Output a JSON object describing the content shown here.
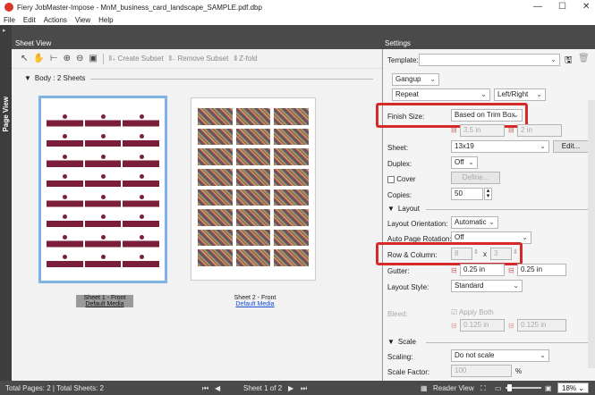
{
  "window": {
    "title": "Fiery JobMaster-Impose - MnM_business_card_landscape_SAMPLE.pdf.dbp",
    "minimize": "—",
    "maximize": "☐",
    "close": "✕"
  },
  "menu": [
    "File",
    "Edit",
    "Actions",
    "View",
    "Help"
  ],
  "rail": {
    "label": "Page View"
  },
  "sheet_view": {
    "header": "Sheet View",
    "toolbar": {
      "create_subset": "Create Subset",
      "remove_subset": "Remove Subset",
      "z_fold": "Z-fold"
    },
    "body_label": "Body : 2 Sheets",
    "sheets": [
      {
        "name": "Sheet 1 - Front",
        "media": "Default Media"
      },
      {
        "name": "Sheet 2 - Front",
        "media": "Default Media"
      }
    ]
  },
  "settings": {
    "header": "Settings",
    "template_label": "Template:",
    "template_value": "",
    "gangup": "Gangup",
    "repeat": "Repeat",
    "left_right": "Left/Right",
    "finish_size_label": "Finish Size:",
    "finish_size_value": "Based on Trim Box",
    "finish_w": "3.5 in",
    "finish_h": "2 in",
    "sheet_label": "Sheet:",
    "sheet_value": "13x19",
    "edit_button": "Edit...",
    "duplex_label": "Duplex:",
    "duplex_value": "Off",
    "cover_label": "Cover",
    "define_button": "Define...",
    "copies_label": "Copies:",
    "copies_value": "50",
    "layout_section": "Layout",
    "layout_orientation_label": "Layout Orientation:",
    "layout_orientation_value": "Automatic",
    "auto_rotation_label": "Auto Page Rotation:",
    "auto_rotation_value": "Off",
    "row_col_label": "Row & Column:",
    "rows": "8",
    "times": "x",
    "cols": "3",
    "gutter_label": "Gutter:",
    "gutter_h": "0.25 in",
    "gutter_v": "0.25 in",
    "layout_style_label": "Layout Style:",
    "layout_style_value": "Standard",
    "bleed_label": "Bleed:",
    "apply_both": "Apply Both",
    "bleed_h": "0.125 in",
    "bleed_v": "0.125 in",
    "scale_section": "Scale",
    "scaling_label": "Scaling:",
    "scaling_value": "Do not scale",
    "scale_factor_label": "Scale Factor:",
    "scale_factor_value": "100",
    "scale_factor_unit": "%"
  },
  "status": {
    "totals": "Total Pages: 2 | Total Sheets: 2",
    "sheet_of": "Sheet 1 of 2",
    "reader_view": "Reader View",
    "zoom": "18%"
  },
  "colors": {
    "highlight": "#d42a2a",
    "selection": "#7fb2e5",
    "card": "#7a1e3a"
  }
}
